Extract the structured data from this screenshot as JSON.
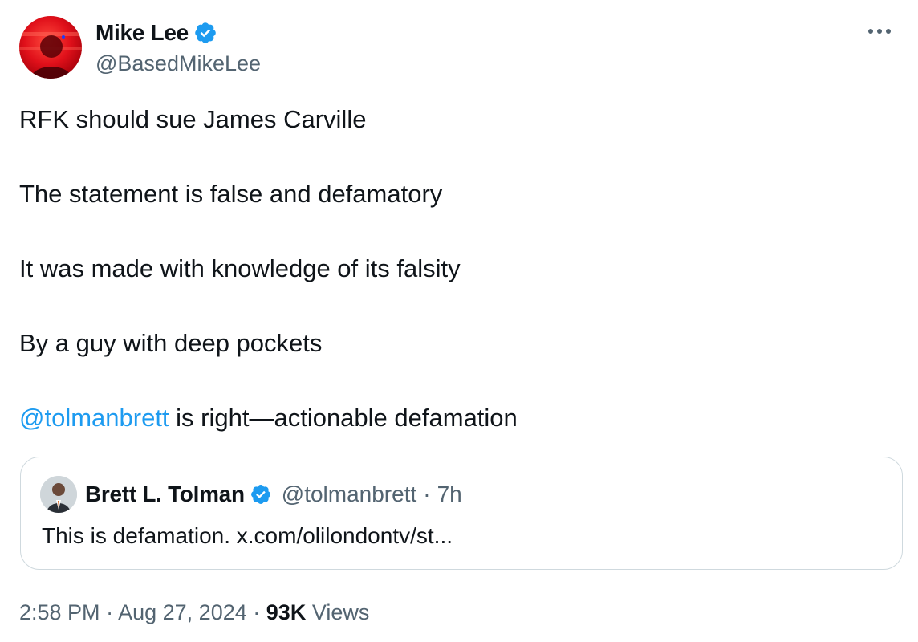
{
  "author": {
    "display_name": "Mike Lee",
    "handle": "@BasedMikeLee",
    "verified_icon": "verified-badge-icon"
  },
  "menu": {
    "more_icon": "more-horizontal-icon",
    "more_label": "•••"
  },
  "body": {
    "line1": "RFK should sue James Carville",
    "line2": "The statement is false and defamatory",
    "line3": "It was made with knowledge of its falsity",
    "line4": "By a guy with deep pockets",
    "mention": "@tolmanbrett",
    "line5_rest": " is right—actionable defamation"
  },
  "quote": {
    "display_name": "Brett L. Tolman",
    "handle": "@tolmanbrett",
    "separator": "·",
    "time": "7h",
    "text": "This is defamation. x.com/olilondontv/st..."
  },
  "footer": {
    "time": "2:58 PM",
    "separator": "·",
    "date": "Aug 27, 2024",
    "views_count": "93K",
    "views_label": "Views"
  },
  "colors": {
    "accent": "#1d9bf0",
    "secondary_text": "#536471",
    "primary_text": "#0f1419",
    "border": "#cfd9de"
  }
}
